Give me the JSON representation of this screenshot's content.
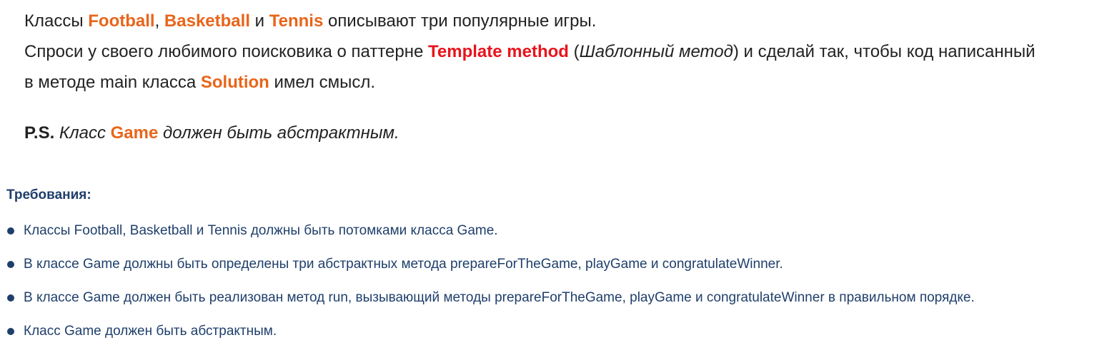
{
  "task": {
    "line1": {
      "t1": "Классы ",
      "football": "Football",
      "t2": ", ",
      "basketball": "Basketball",
      "t3": " и ",
      "tennis": "Tennis",
      "t4": " описывают три популярные игры."
    },
    "line2": {
      "t1": "Спроси у своего любимого поисковика о паттерне ",
      "pattern": "Template method",
      "t2": " (",
      "pattern_ru": "Шаблонный метод",
      "t3": ") и сделай так, чтобы код написанный",
      "t4": "в методе main класса ",
      "solution": "Solution",
      "t5": " имел смысл."
    },
    "ps": {
      "label": "P.S.",
      "t1": " Класс ",
      "game": "Game",
      "t2": " должен быть абстрактным."
    }
  },
  "requirements": {
    "title": "Требования:",
    "items": [
      "Классы Football, Basketball и Tennis должны быть потомками класса Game.",
      "В классе Game должны быть определены три абстрактных метода prepareForTheGame, playGame и congratulateWinner.",
      "В классе Game должен быть реализован метод run, вызывающий методы prepareForTheGame, playGame и congratulateWinner в правильном порядке.",
      "Класс Game должен быть абстрактным."
    ]
  },
  "colors": {
    "class_highlight": "#e8651a",
    "pattern_highlight": "#e8141c",
    "requirements_text": "#1f3f6b",
    "body_text": "#222222"
  }
}
